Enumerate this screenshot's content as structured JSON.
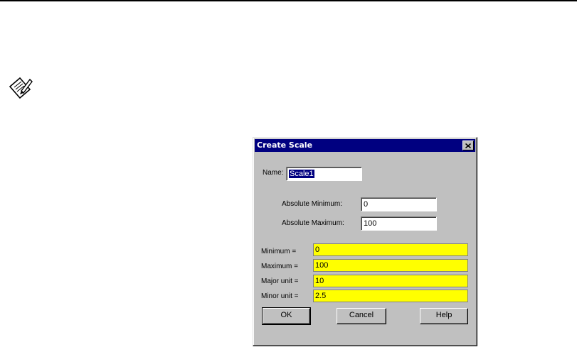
{
  "dialog": {
    "title": "Create Scale",
    "name_label": "Name:",
    "name_value": "Scale1",
    "abs_min_label": "Absolute Minimum:",
    "abs_min_value": "0",
    "abs_max_label": "Absolute Maximum:",
    "abs_max_value": "100",
    "minimum_label": "Minimum =",
    "minimum_value": "0",
    "maximum_label": "Maximum =",
    "maximum_value": "100",
    "major_label": "Major unit =",
    "major_value": "10",
    "minor_label": "Minor unit =",
    "minor_value": "2.5",
    "ok_label": "OK",
    "cancel_label": "Cancel",
    "help_label": "Help"
  },
  "icons": {
    "note": "note-pencil-icon",
    "close": "close-icon"
  },
  "colors": {
    "titlebar": "#000080",
    "highlight_field": "#ffff00",
    "dialog_face": "#c0c0c0"
  }
}
